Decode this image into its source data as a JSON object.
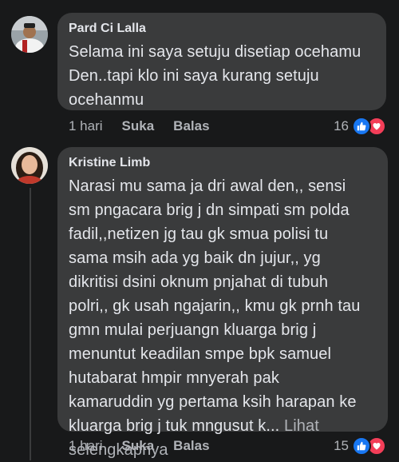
{
  "comments": [
    {
      "author": "Pard Ci Lalla",
      "text": "Selama ini saya setuju disetiap ocehamu\nDen..tapi klo ini saya kurang setuju\nocehanmu",
      "time": "1 hari",
      "like_label": "Suka",
      "reply_label": "Balas",
      "reaction_count": "16"
    },
    {
      "author": "Kristine Limb",
      "text": "Narasi mu sama ja dri awal den,, sensi\nsm pngacara brig j dn simpati sm polda\nfadil,,netizen jg tau gk smua polisi tu\nsama msih ada yg baik dn jujur,, yg\ndikritisi dsini oknum pnjahat di tubuh\npolri,, gk usah ngajarin,, kmu gk prnh tau\ngmn mulai perjuangn kluarga brig j\nmenuntut keadilan smpe bpk samuel\nhutabarat hmpir mnyerah  pak\nkamaruddin yg pertama ksih harapan ke\nkluarga brig j tuk mngusut k... ",
      "see_more": "Lihat\nselengkapnya",
      "time": "1 hari",
      "like_label": "Suka",
      "reply_label": "Balas",
      "reaction_count": "15"
    }
  ],
  "colors": {
    "background": "#18191a",
    "bubble": "#3a3b3c",
    "like_blue": "#1877f2",
    "love_red": "#f33e58"
  },
  "icons": [
    "like-icon",
    "love-icon"
  ]
}
